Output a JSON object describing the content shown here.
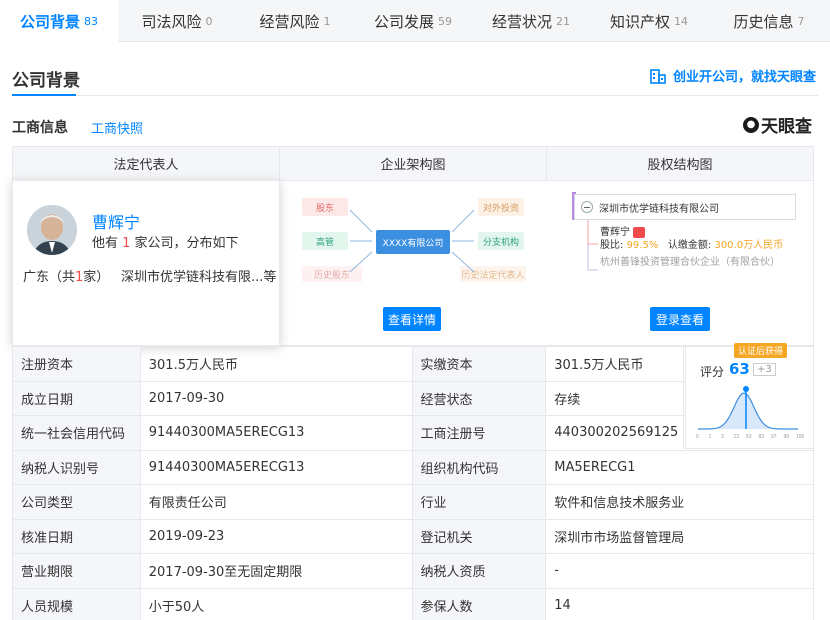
{
  "tabs": [
    {
      "label": "公司背景",
      "count": "83"
    },
    {
      "label": "司法风险",
      "count": "0"
    },
    {
      "label": "经营风险",
      "count": "1"
    },
    {
      "label": "公司发展",
      "count": "59"
    },
    {
      "label": "经营状况",
      "count": "21"
    },
    {
      "label": "知识产权",
      "count": "14"
    },
    {
      "label": "历史信息",
      "count": "7"
    }
  ],
  "section": {
    "title": "公司背景",
    "promo": "创业开公司，就找天眼查",
    "sub_title": "工商信息",
    "sub_link": "工商快照",
    "logo": "天眼查",
    "logo_mark": "●"
  },
  "panel": {
    "col_rep": "法定代表人",
    "col_org": "企业架构图",
    "col_share": "股权结构图"
  },
  "person": {
    "name": "曹辉宁",
    "desc_pre": "他有 ",
    "desc_num": "1",
    "desc_post": " 家公司，分布如下",
    "region_pre": "广东（共",
    "region_num": "1",
    "region_post": "家）",
    "company": "深圳市优学链科技有限...等"
  },
  "org": {
    "shareholder": "股东",
    "manager": "高管",
    "history_holder": "历史股东",
    "center": "XXXX有限公司",
    "investment": "对外投资",
    "branch": "分支机构",
    "history_rep": "历史法定代表人",
    "button": "查看详情"
  },
  "share": {
    "company": "深圳市优学链科技有限公司",
    "holder": "曹辉宁",
    "holder_tag": "",
    "ratio_label": "股比:",
    "ratio": "99.5%",
    "amount_label": "认缴金额:",
    "amount": "300.0万人民币",
    "holder2": "杭州善锋投资管理合伙企业（有限合伙）",
    "button": "登录查看"
  },
  "score": {
    "badge": "认证后获得",
    "label": "评分",
    "value": "63",
    "plus": "+3",
    "ticks": [
      "0",
      "1",
      "3",
      "13",
      "53",
      "83",
      "97",
      "99",
      "100"
    ],
    "value_pct": 63
  },
  "rows": [
    {
      "k1": "注册资本",
      "v1": "301.5万人民币",
      "k2": "实缴资本",
      "v2": "301.5万人民币"
    },
    {
      "k1": "成立日期",
      "v1": "2017-09-30",
      "k2": "经营状态",
      "v2": "存续"
    },
    {
      "k1": "统一社会信用代码",
      "v1": "91440300MA5ERECG13",
      "k2": "工商注册号",
      "v2": "440300202569125"
    },
    {
      "k1": "纳税人识别号",
      "v1": "91440300MA5ERECG13",
      "k2": "组织机构代码",
      "v2": "MA5ERECG1"
    },
    {
      "k1": "公司类型",
      "v1": "有限责任公司",
      "k2": "行业",
      "v2": "软件和信息技术服务业"
    },
    {
      "k1": "核准日期",
      "v1": "2019-09-23",
      "k2": "登记机关",
      "v2": "深圳市市场监督管理局"
    },
    {
      "k1": "营业期限",
      "v1": "2017-09-30至无固定期限",
      "k2": "纳税人资质",
      "v2": "-"
    },
    {
      "k1": "人员规模",
      "v1": "小于50人",
      "k2": "参保人数",
      "v2": "14"
    }
  ],
  "colors": {
    "accent": "#0084ff",
    "red": "#f04a4a",
    "badge": "#f5a623"
  }
}
